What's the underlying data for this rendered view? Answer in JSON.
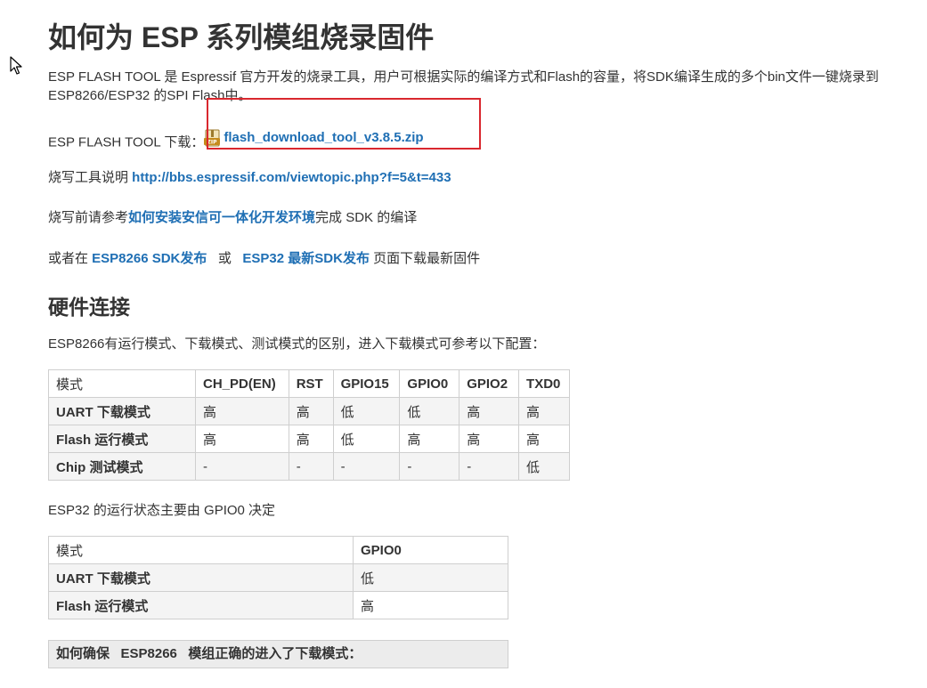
{
  "title": "如何为 ESP 系列模组烧录固件",
  "intro": {
    "line1": "ESP FLASH TOOL 是 Espressif 官方开发的烧录工具，用户可根据实际的编译方式和Flash的容量，将SDK编译生成的多个bin文件一键烧录到",
    "line2": "ESP8266/ESP32 的SPI Flash中。"
  },
  "download": {
    "label": "ESP FLASH TOOL 下载：",
    "icon": "zip-file-icon",
    "link_text": "flash_download_tool_v3.8.5.zip",
    "highlight_color": "#d9272e"
  },
  "guide": {
    "label": "烧写工具说明 ",
    "link_text": "http://bbs.espressif.com/viewtopic.php?f=5&t=433"
  },
  "prereq": {
    "before": "烧写前请参考",
    "link_text": "如何安装安信可一体化开发环境",
    "after": "完成 SDK 的编译"
  },
  "release": {
    "before": "或者在 ",
    "link1": "ESP8266 SDK发布",
    "middle": "   或   ",
    "link2": "ESP32 最新SDK发布",
    "after": " 页面下载最新固件"
  },
  "hardware": {
    "heading": "硬件连接",
    "esp8266_note": "ESP8266有运行模式、下载模式、测试模式的区别，进入下载模式可参考以下配置：",
    "esp8266_table": {
      "headers": [
        "模式",
        "CH_PD(EN)",
        "RST",
        "GPIO15",
        "GPIO0",
        "GPIO2",
        "TXD0"
      ],
      "rows": [
        [
          "UART 下载模式",
          "高",
          "高",
          "低",
          "低",
          "高",
          "高"
        ],
        [
          "Flash 运行模式",
          "高",
          "高",
          "低",
          "高",
          "高",
          "高"
        ],
        [
          "Chip 测试模式",
          "-",
          "-",
          "-",
          "-",
          "-",
          "低"
        ]
      ]
    },
    "esp32_note": "ESP32 的运行状态主要由 GPIO0 决定",
    "esp32_table": {
      "headers": [
        "模式",
        "GPIO0"
      ],
      "rows": [
        [
          "UART 下载模式",
          "低"
        ],
        [
          "Flash 运行模式",
          "高"
        ]
      ]
    },
    "check_heading": "如何确保   ESP8266   模组正确的进入了下载模式："
  },
  "link_color": "#1f6fb4",
  "cursor_icon": "mouse-pointer-icon"
}
